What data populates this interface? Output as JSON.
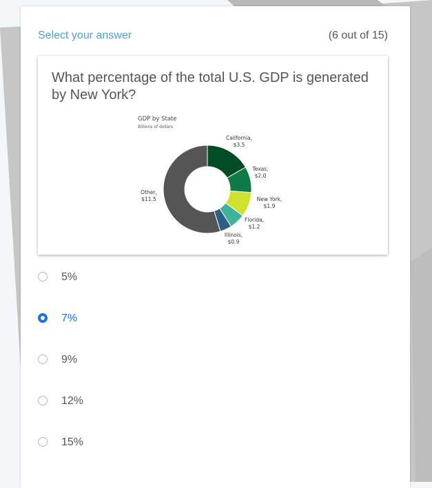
{
  "header": {
    "select_label": "Select your answer",
    "progress": "(6 out of 15)"
  },
  "question": {
    "text": "What percentage of the total U.S. GDP is generated by New York?"
  },
  "chart_data": {
    "type": "pie",
    "donut": true,
    "title": "GDP by State",
    "subtitle": "Billions of dollars",
    "slices": [
      {
        "label": "California,",
        "value_label": "$3.5",
        "value": 3.5,
        "color": "#004d25"
      },
      {
        "label": "Texas,",
        "value_label": "$2.0",
        "value": 2.0,
        "color": "#0e7a48"
      },
      {
        "label": "New York,",
        "value_label": "$1.9",
        "value": 1.9,
        "color": "#d0e02e"
      },
      {
        "label": "Florida,",
        "value_label": "$1.2",
        "value": 1.2,
        "color": "#3fb29b"
      },
      {
        "label": "Illinois,",
        "value_label": "$0.9",
        "value": 0.9,
        "color": "#2b5f86"
      },
      {
        "label": "Other,",
        "value_label": "$11.5",
        "value": 11.5,
        "color": "#555555"
      }
    ]
  },
  "options": [
    {
      "label": "5%",
      "selected": false
    },
    {
      "label": "7%",
      "selected": true
    },
    {
      "label": "9%",
      "selected": false
    },
    {
      "label": "12%",
      "selected": false
    },
    {
      "label": "15%",
      "selected": false
    }
  ],
  "colors": {
    "accent": "#1a73e8",
    "header_link": "#4a9fd8",
    "text": "#555555"
  }
}
